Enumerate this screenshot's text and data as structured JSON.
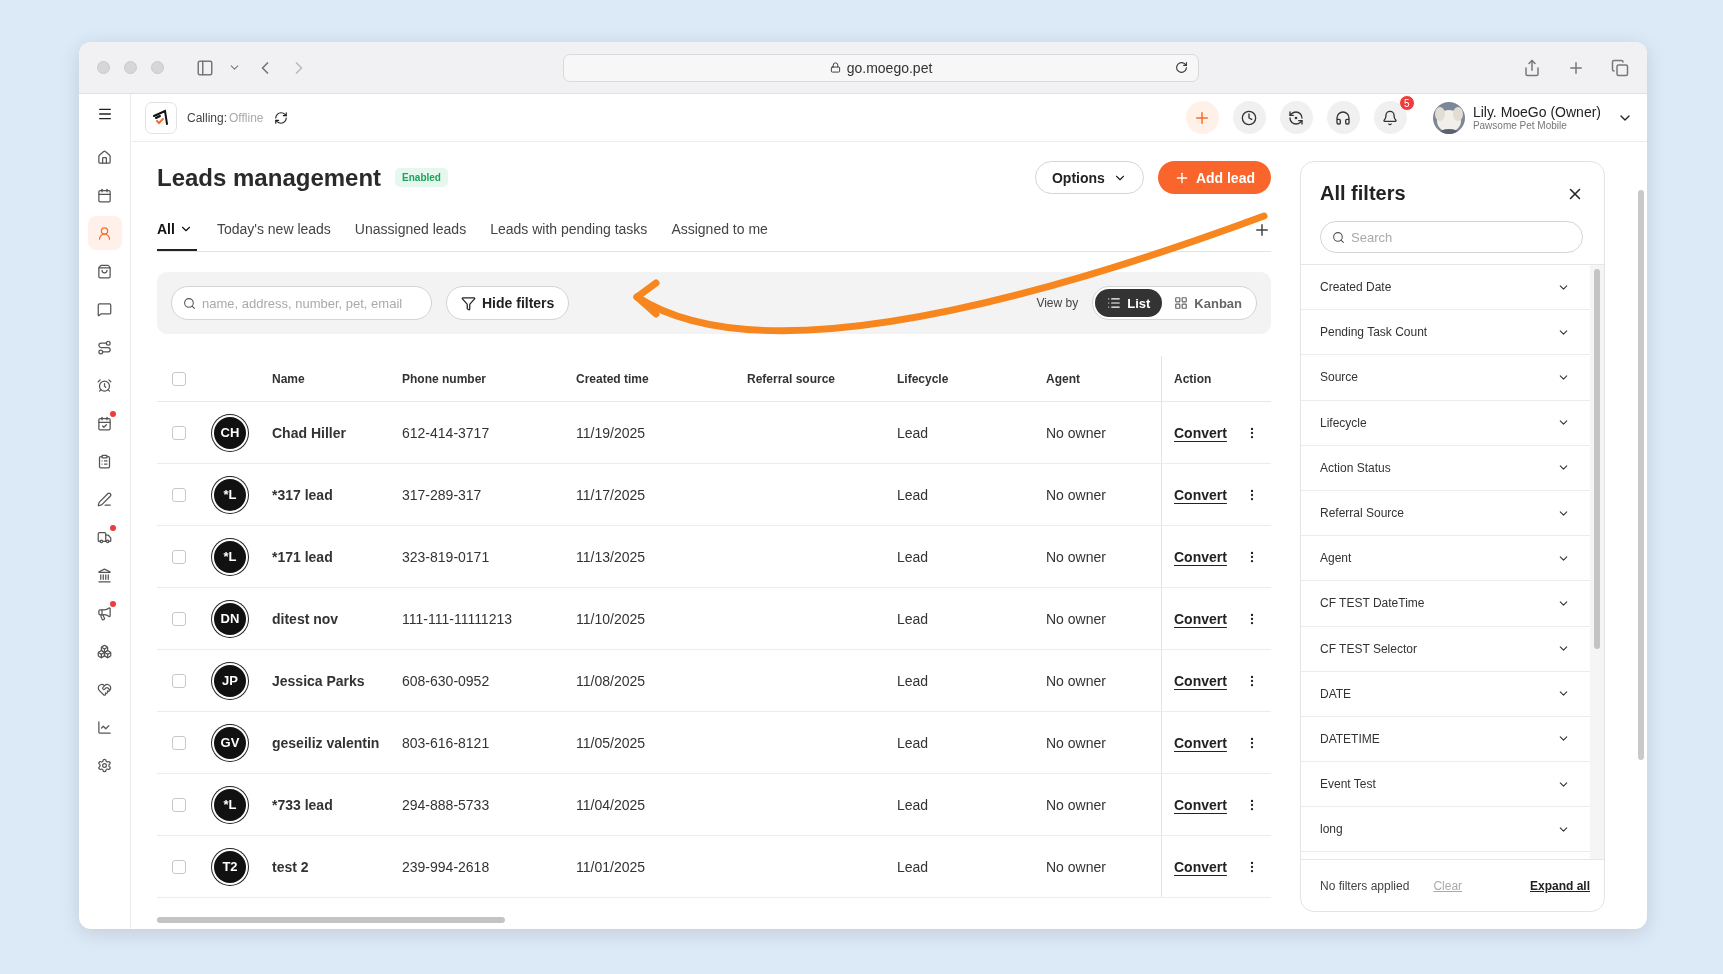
{
  "browser": {
    "url": "go.moego.pet"
  },
  "header": {
    "calling_label": "Calling:",
    "calling_status": "Offline",
    "notifications": "5",
    "user_name": "Lily. MoeGo (Owner)",
    "user_org": "Pawsome Pet Mobile"
  },
  "sidebar": {
    "items": [
      {
        "kind": "home",
        "selected": false,
        "alert": false
      },
      {
        "kind": "calendar",
        "selected": false,
        "alert": false
      },
      {
        "kind": "leads",
        "selected": true,
        "alert": false
      },
      {
        "kind": "bag",
        "selected": false,
        "alert": false
      },
      {
        "kind": "message",
        "selected": false,
        "alert": false
      },
      {
        "kind": "route",
        "selected": false,
        "alert": false
      },
      {
        "kind": "alarm",
        "selected": false,
        "alert": false
      },
      {
        "kind": "schedule",
        "selected": false,
        "alert": true
      },
      {
        "kind": "clipboard",
        "selected": false,
        "alert": false
      },
      {
        "kind": "pen",
        "selected": false,
        "alert": false
      },
      {
        "kind": "truck",
        "selected": false,
        "alert": true
      },
      {
        "kind": "bank",
        "selected": false,
        "alert": false
      },
      {
        "kind": "megaphone",
        "selected": false,
        "alert": true
      },
      {
        "kind": "boxes",
        "selected": false,
        "alert": false
      },
      {
        "kind": "heart",
        "selected": false,
        "alert": false
      },
      {
        "kind": "chart",
        "selected": false,
        "alert": false
      },
      {
        "kind": "settings",
        "selected": false,
        "alert": false
      }
    ]
  },
  "page": {
    "title": "Leads management",
    "status": "Enabled",
    "options": "Options",
    "add": "Add lead"
  },
  "tabs": [
    {
      "label": "All",
      "selected": true,
      "kind": "dropdown"
    },
    {
      "label": "Today's new leads",
      "selected": false,
      "kind": "plain"
    },
    {
      "label": "Unassigned leads",
      "selected": false,
      "kind": "plain"
    },
    {
      "label": "Leads with pending tasks",
      "selected": false,
      "kind": "plain"
    },
    {
      "label": "Assigned to me",
      "selected": false,
      "kind": "plain"
    }
  ],
  "toolbar": {
    "search_placeholder": "name, address, number, pet, email",
    "hide_filters": "Hide filters",
    "view_by": "View by",
    "views": [
      {
        "label": "List",
        "kind": "list",
        "selected": true
      },
      {
        "label": "Kanban",
        "kind": "kanban",
        "selected": false
      }
    ]
  },
  "table": {
    "select_all_checked": false,
    "columns": [
      "Name",
      "Phone number",
      "Created time",
      "Referral source",
      "Lifecycle",
      "Agent",
      "Action"
    ],
    "rows": [
      {
        "initials": "CH",
        "name": "Chad Hiller",
        "phone": "612-414-3717",
        "created": "11/19/2025",
        "lifecycle": "Lead",
        "agent": "No owner",
        "action": "Convert",
        "checked": false
      },
      {
        "initials": "*L",
        "name": "*317 lead",
        "phone": "317-289-317",
        "created": "11/17/2025",
        "lifecycle": "Lead",
        "agent": "No owner",
        "action": "Convert",
        "checked": false
      },
      {
        "initials": "*L",
        "name": "*171 lead",
        "phone": "323-819-0171",
        "created": "11/13/2025",
        "lifecycle": "Lead",
        "agent": "No owner",
        "action": "Convert",
        "checked": false
      },
      {
        "initials": "DN",
        "name": "ditest nov",
        "phone": "111-111-11111213",
        "created": "11/10/2025",
        "lifecycle": "Lead",
        "agent": "No owner",
        "action": "Convert",
        "checked": false
      },
      {
        "initials": "JP",
        "name": "Jessica Parks",
        "phone": "608-630-0952",
        "created": "11/08/2025",
        "lifecycle": "Lead",
        "agent": "No owner",
        "action": "Convert",
        "checked": false
      },
      {
        "initials": "GV",
        "name": "geseiliz valentin",
        "phone": "803-616-8121",
        "created": "11/05/2025",
        "lifecycle": "Lead",
        "agent": "No owner",
        "action": "Convert",
        "checked": false
      },
      {
        "initials": "*L",
        "name": "*733 lead",
        "phone": "294-888-5733",
        "created": "11/04/2025",
        "lifecycle": "Lead",
        "agent": "No owner",
        "action": "Convert",
        "checked": false
      },
      {
        "initials": "T2",
        "name": "test 2",
        "phone": "239-994-2618",
        "created": "11/01/2025",
        "lifecycle": "Lead",
        "agent": "No owner",
        "action": "Convert",
        "checked": false
      }
    ]
  },
  "filters": {
    "title": "All filters",
    "search_placeholder": "Search",
    "items": [
      {
        "label": "Created Date",
        "expanded": false
      },
      {
        "label": "Pending Task Count",
        "expanded": false
      },
      {
        "label": "Source",
        "expanded": false
      },
      {
        "label": "Lifecycle",
        "expanded": false
      },
      {
        "label": "Action Status",
        "expanded": false
      },
      {
        "label": "Referral Source",
        "expanded": false
      },
      {
        "label": "Agent",
        "expanded": false
      },
      {
        "label": "CF TEST DateTime",
        "expanded": false
      },
      {
        "label": "CF TEST Selector",
        "expanded": false
      },
      {
        "label": "DATE",
        "expanded": false
      },
      {
        "label": "DATETIME",
        "expanded": false
      },
      {
        "label": "Event Test",
        "expanded": false
      },
      {
        "label": "long",
        "expanded": false
      }
    ],
    "status": "No filters applied",
    "clear": "Clear",
    "expand_all": "Expand all"
  }
}
